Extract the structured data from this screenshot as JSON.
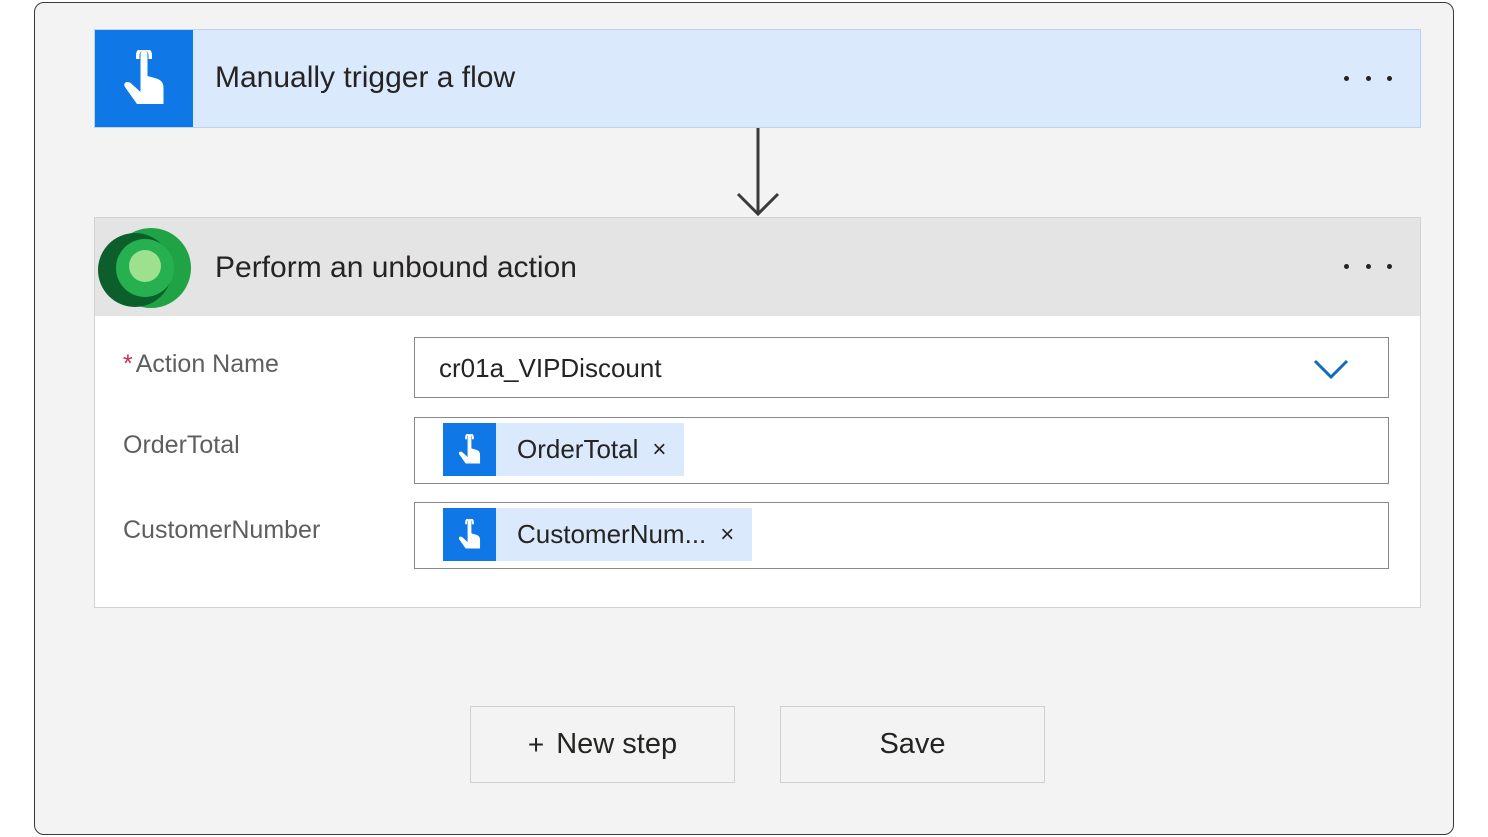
{
  "trigger": {
    "title": "Manually trigger a flow",
    "icon": "touch-hand-icon",
    "more_label": "More options"
  },
  "action": {
    "title": "Perform an unbound action",
    "icon": "dataverse-logo-icon",
    "fields": {
      "action_name": {
        "label": "Action Name",
        "required_mark": "*",
        "value": "cr01a_VIPDiscount"
      },
      "order_total": {
        "label": "OrderTotal",
        "token": "OrderTotal",
        "remove": "×"
      },
      "customer_number": {
        "label": "CustomerNumber",
        "token": "CustomerNum...",
        "remove": "×"
      }
    }
  },
  "buttons": {
    "new_step_plus": "+",
    "new_step": "New step",
    "save": "Save"
  },
  "colors": {
    "trigger_accent": "#0f78e6",
    "trigger_bg": "#dae9fc",
    "action_header_bg": "#e4e4e4",
    "canvas_bg": "#f3f3f3",
    "required": "#c4314b"
  }
}
